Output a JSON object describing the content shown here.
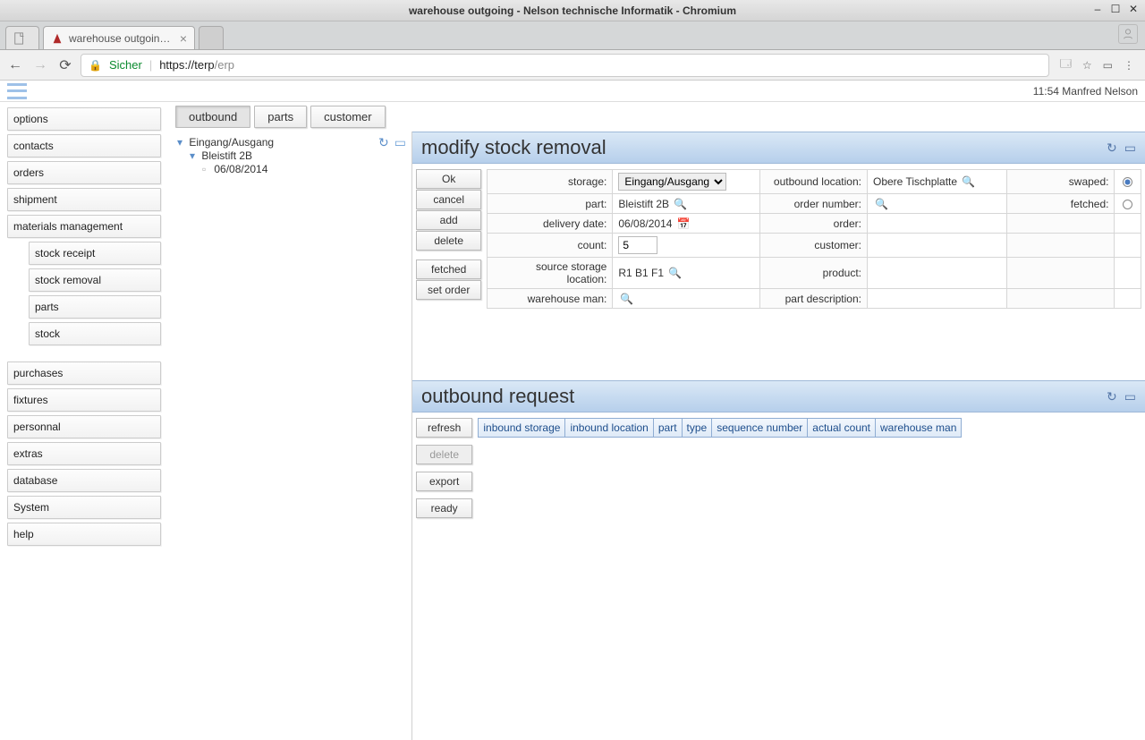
{
  "os": {
    "title": "warehouse outgoing - Nelson technische Informatik - Chromium"
  },
  "browser": {
    "tabs": [
      {
        "label": ""
      },
      {
        "label": "warehouse outgoing - Ne"
      }
    ],
    "secure_label": "Sicher",
    "url_strong": "https://terp",
    "url_rest": "/erp"
  },
  "session": {
    "time": "11:54",
    "user": "Manfred Nelson"
  },
  "sidebar": {
    "items": [
      "options",
      "contacts",
      "orders",
      "shipment",
      "materials management"
    ],
    "materials_sub": [
      "stock receipt",
      "stock removal",
      "parts",
      "stock"
    ],
    "items2": [
      "purchases",
      "fixtures",
      "personnal",
      "extras",
      "database",
      "System",
      "help"
    ]
  },
  "maintabs": [
    "outbound",
    "parts",
    "customer"
  ],
  "tree": {
    "root": "Eingang/Ausgang",
    "child": "Bleistift 2B",
    "leaf": "06/08/2014"
  },
  "panel1": {
    "title": "modify stock removal",
    "buttons_grp1": [
      "Ok",
      "cancel",
      "add",
      "delete"
    ],
    "buttons_grp2": [
      "fetched",
      "set order"
    ],
    "labels": {
      "storage": "storage:",
      "outbound_location": "outbound location:",
      "swaped": "swaped:",
      "part": "part:",
      "order_number": "order number:",
      "fetched": "fetched:",
      "delivery_date": "delivery date:",
      "order": "order:",
      "count": "count:",
      "customer": "customer:",
      "source_storage": "source storage location:",
      "product": "product:",
      "warehouse_man": "warehouse man:",
      "part_description": "part description:"
    },
    "values": {
      "storage": "Eingang/Ausgang",
      "outbound_location": "Obere Tischplatte",
      "part": "Bleistift 2B",
      "delivery_date": "06/08/2014",
      "count": "5",
      "source_storage": "R1 B1 F1"
    }
  },
  "panel2": {
    "title": "outbound request",
    "left_buttons": [
      "refresh",
      "delete",
      "export",
      "ready"
    ],
    "columns": [
      "inbound storage",
      "inbound location",
      "part",
      "type",
      "sequence number",
      "actual count",
      "warehouse man"
    ]
  }
}
